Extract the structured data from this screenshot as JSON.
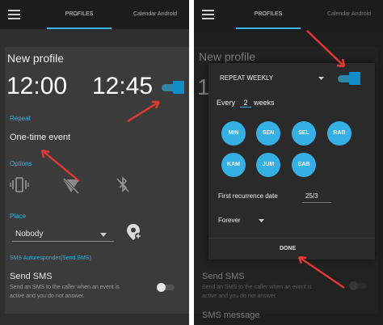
{
  "left": {
    "tabs": [
      "PROFILES",
      "Calendar Android"
    ],
    "title": "New profile",
    "time_start": "12:00",
    "time_end": "12:45",
    "repeat_header": "Repeat",
    "repeat_value": "One-time event",
    "options_header": "Options",
    "place_header": "Place",
    "place_value": "Nobody",
    "sms_header": "SMS Autoresponder(Send SMS)",
    "sms_title": "Send SMS",
    "sms_desc_1": "Send an SMS to the caller when an event is",
    "sms_desc_2": "active and you do not answer."
  },
  "right": {
    "tabs": [
      "PROFILES",
      "Calendar Android"
    ],
    "bg_title": "New profile",
    "bg_time": "1",
    "dialog": {
      "mode": "REPEAT WEEKLY",
      "every_label": "Every",
      "every_value": "2",
      "every_unit": "weeks",
      "days_row1": [
        "MIN",
        "SEN",
        "SEL",
        "RAB"
      ],
      "days_row2": [
        "KAM",
        "JUM",
        "SAB"
      ],
      "first_label": "First recurrence date",
      "first_value": "25/3",
      "duration": "Forever",
      "done": "DONE"
    },
    "bg_sms_title": "Send SMS",
    "bg_sms_desc_1": "Send an SMS to the caller when an event is",
    "bg_sms_desc_2": "active and you do not answer.",
    "bg_sms_message": "SMS message"
  },
  "colors": {
    "accent": "#35b0e4",
    "arrow": "#e53935",
    "panel": "#2f2f2f",
    "card": "#3b3b3b",
    "topbar": "#1c1c1c"
  },
  "icons": [
    "menu-icon",
    "vibrate-icon",
    "wifi-off-icon",
    "bluetooth-off-icon",
    "add-location-icon",
    "dropdown-icon"
  ]
}
